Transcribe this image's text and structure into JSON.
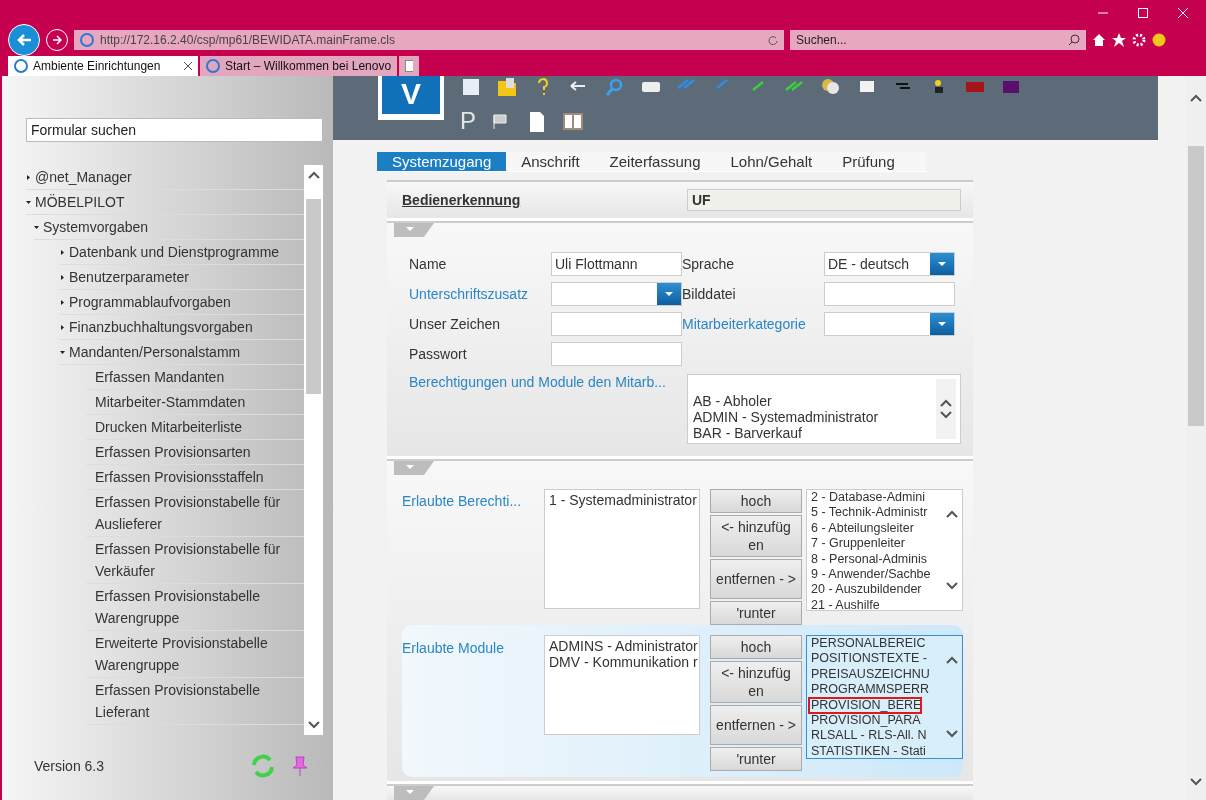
{
  "browser": {
    "url": "http://172.16.2.40/csp/mp61/BEWIDATA.mainFrame.cls",
    "search": {
      "placeholder": "Suchen..."
    },
    "tabs": [
      {
        "label": "Ambiente Einrichtungen",
        "selected": true
      },
      {
        "label": "Start – Willkommen bei Lenovo",
        "selected": false
      }
    ]
  },
  "sidebar": {
    "search": {
      "placeholder": "Formular suchen"
    },
    "tree": [
      {
        "label": "@net_Manager",
        "expanded": false
      },
      {
        "label": "MÖBELPILOT",
        "expanded": true,
        "children": [
          {
            "label": "Systemvorgaben",
            "expanded": true,
            "children": [
              {
                "label": "Datenbank und Dienstprogramme",
                "expanded": false
              },
              {
                "label": "Benutzerparameter",
                "expanded": false
              },
              {
                "label": "Programmablaufvorgaben",
                "expanded": false
              },
              {
                "label": "Finanzbuchhaltungsvorgaben",
                "expanded": false
              },
              {
                "label": "Mandanten/Personalstamm",
                "expanded": true,
                "children": [
                  {
                    "label": "Erfassen Mandanten"
                  },
                  {
                    "label": "Mitarbeiter-Stammdaten"
                  },
                  {
                    "label": "Drucken Mitarbeiterliste"
                  },
                  {
                    "label": "Erfassen Provisionsarten"
                  },
                  {
                    "label": "Erfassen Provisionsstaffeln"
                  },
                  {
                    "label": "Erfassen Provisionstabelle für Auslieferer"
                  },
                  {
                    "label": "Erfassen Provisionstabelle für Verkäufer"
                  },
                  {
                    "label": "Erfassen Provisionstabelle Warengruppe"
                  },
                  {
                    "label": "Erweiterte Provisionstabelle Warengruppe"
                  },
                  {
                    "label": "Erfassen Provisionstabelle Lieferant"
                  }
                ]
              }
            ]
          }
        ]
      }
    ],
    "version": "Version 6.3"
  },
  "toolbar": {
    "logo": "V",
    "row_1": [
      {
        "kind": "page"
      },
      {
        "kind": "folder"
      },
      {
        "kind": "help"
      },
      {
        "kind": "undo"
      },
      {
        "kind": "search"
      },
      {
        "kind": "printer"
      },
      {
        "kind": "first"
      },
      {
        "kind": "prev"
      },
      {
        "kind": "next"
      },
      {
        "kind": "last"
      },
      {
        "kind": "coins"
      },
      {
        "kind": "list"
      },
      {
        "kind": "tree"
      },
      {
        "kind": "person"
      },
      {
        "kind": "truck"
      },
      {
        "kind": "grid"
      }
    ],
    "row_2": [
      {
        "kind": "letter",
        "label": "P"
      },
      {
        "kind": "flag"
      },
      {
        "kind": "document"
      },
      {
        "kind": "book"
      }
    ]
  },
  "tabs": [
    {
      "label": "Systemzugang",
      "selected": true
    },
    {
      "label": "Anschrift",
      "selected": false
    },
    {
      "label": "Zeiterfassung",
      "selected": false
    },
    {
      "label": "Lohn/Gehalt",
      "selected": false
    },
    {
      "label": "Prüfung",
      "selected": false
    }
  ],
  "operator": {
    "label": "Bedienerkennung",
    "value": "UF"
  },
  "fields": [
    {
      "label": "Name",
      "kind": "text",
      "link": false,
      "value": "Uli Flottmann"
    },
    {
      "label": "Sprache",
      "kind": "select",
      "link": false,
      "value": "DE - deutsch"
    },
    {
      "label": "Unterschriftszusatz",
      "kind": "select",
      "link": true
    },
    {
      "label": "Bilddatei",
      "kind": "text",
      "link": false
    },
    {
      "label": "Unser Zeichen",
      "kind": "text",
      "link": false
    },
    {
      "label": "Mitarbeiterkategorie",
      "kind": "select",
      "link": true
    },
    {
      "label": "Passwort",
      "kind": "text",
      "link": false
    }
  ],
  "permissions": {
    "label": "Berechtigungen und Module den Mitarb...",
    "items": [
      "AB - Abholer",
      "ADMIN - Systemadministrator",
      "BAR - Barverkauf"
    ]
  },
  "assignments": [
    {
      "label": "Erlaubte Berechti...",
      "focused": false,
      "assigned": [
        "1 - Systemadministrator"
      ],
      "buttons": [
        "hoch",
        "<- hinzufüg en",
        "entfernen - >",
        "'runter"
      ],
      "available": [
        {
          "label": "2 - Database-Admini",
          "selected": false
        },
        {
          "label": "5 - Technik-Administr",
          "selected": false
        },
        {
          "label": "6 - Abteilungsleiter",
          "selected": false
        },
        {
          "label": "7 - Gruppenleiter",
          "selected": false
        },
        {
          "label": "8 - Personal-Adminis",
          "selected": false
        },
        {
          "label": "9 - Anwender/Sachbe",
          "selected": false
        },
        {
          "label": "20 - Auszubildender",
          "selected": false
        },
        {
          "label": "21 - Aushilfe",
          "selected": false
        }
      ]
    },
    {
      "label": "Erlaubte Module",
      "focused": true,
      "assigned": [
        "ADMINS - Administrator",
        "DMV - Kommunikation r"
      ],
      "buttons": [
        "hoch",
        "<- hinzufüg en",
        "entfernen - >",
        "'runter"
      ],
      "available": [
        {
          "label": "PERSONALBEREIC",
          "selected": false
        },
        {
          "label": "POSITIONSTEXTE -",
          "selected": false
        },
        {
          "label": "PREISAUSZEICHNU",
          "selected": false
        },
        {
          "label": "PROGRAMMSPERR",
          "selected": false
        },
        {
          "label": "PROVISION_BERE",
          "selected": true
        },
        {
          "label": "PROVISION_PARA",
          "selected": false
        },
        {
          "label": "RLSALL - RLS-All. N",
          "selected": false
        },
        {
          "label": "STATISTIKEN - Stati",
          "selected": false
        }
      ]
    }
  ]
}
